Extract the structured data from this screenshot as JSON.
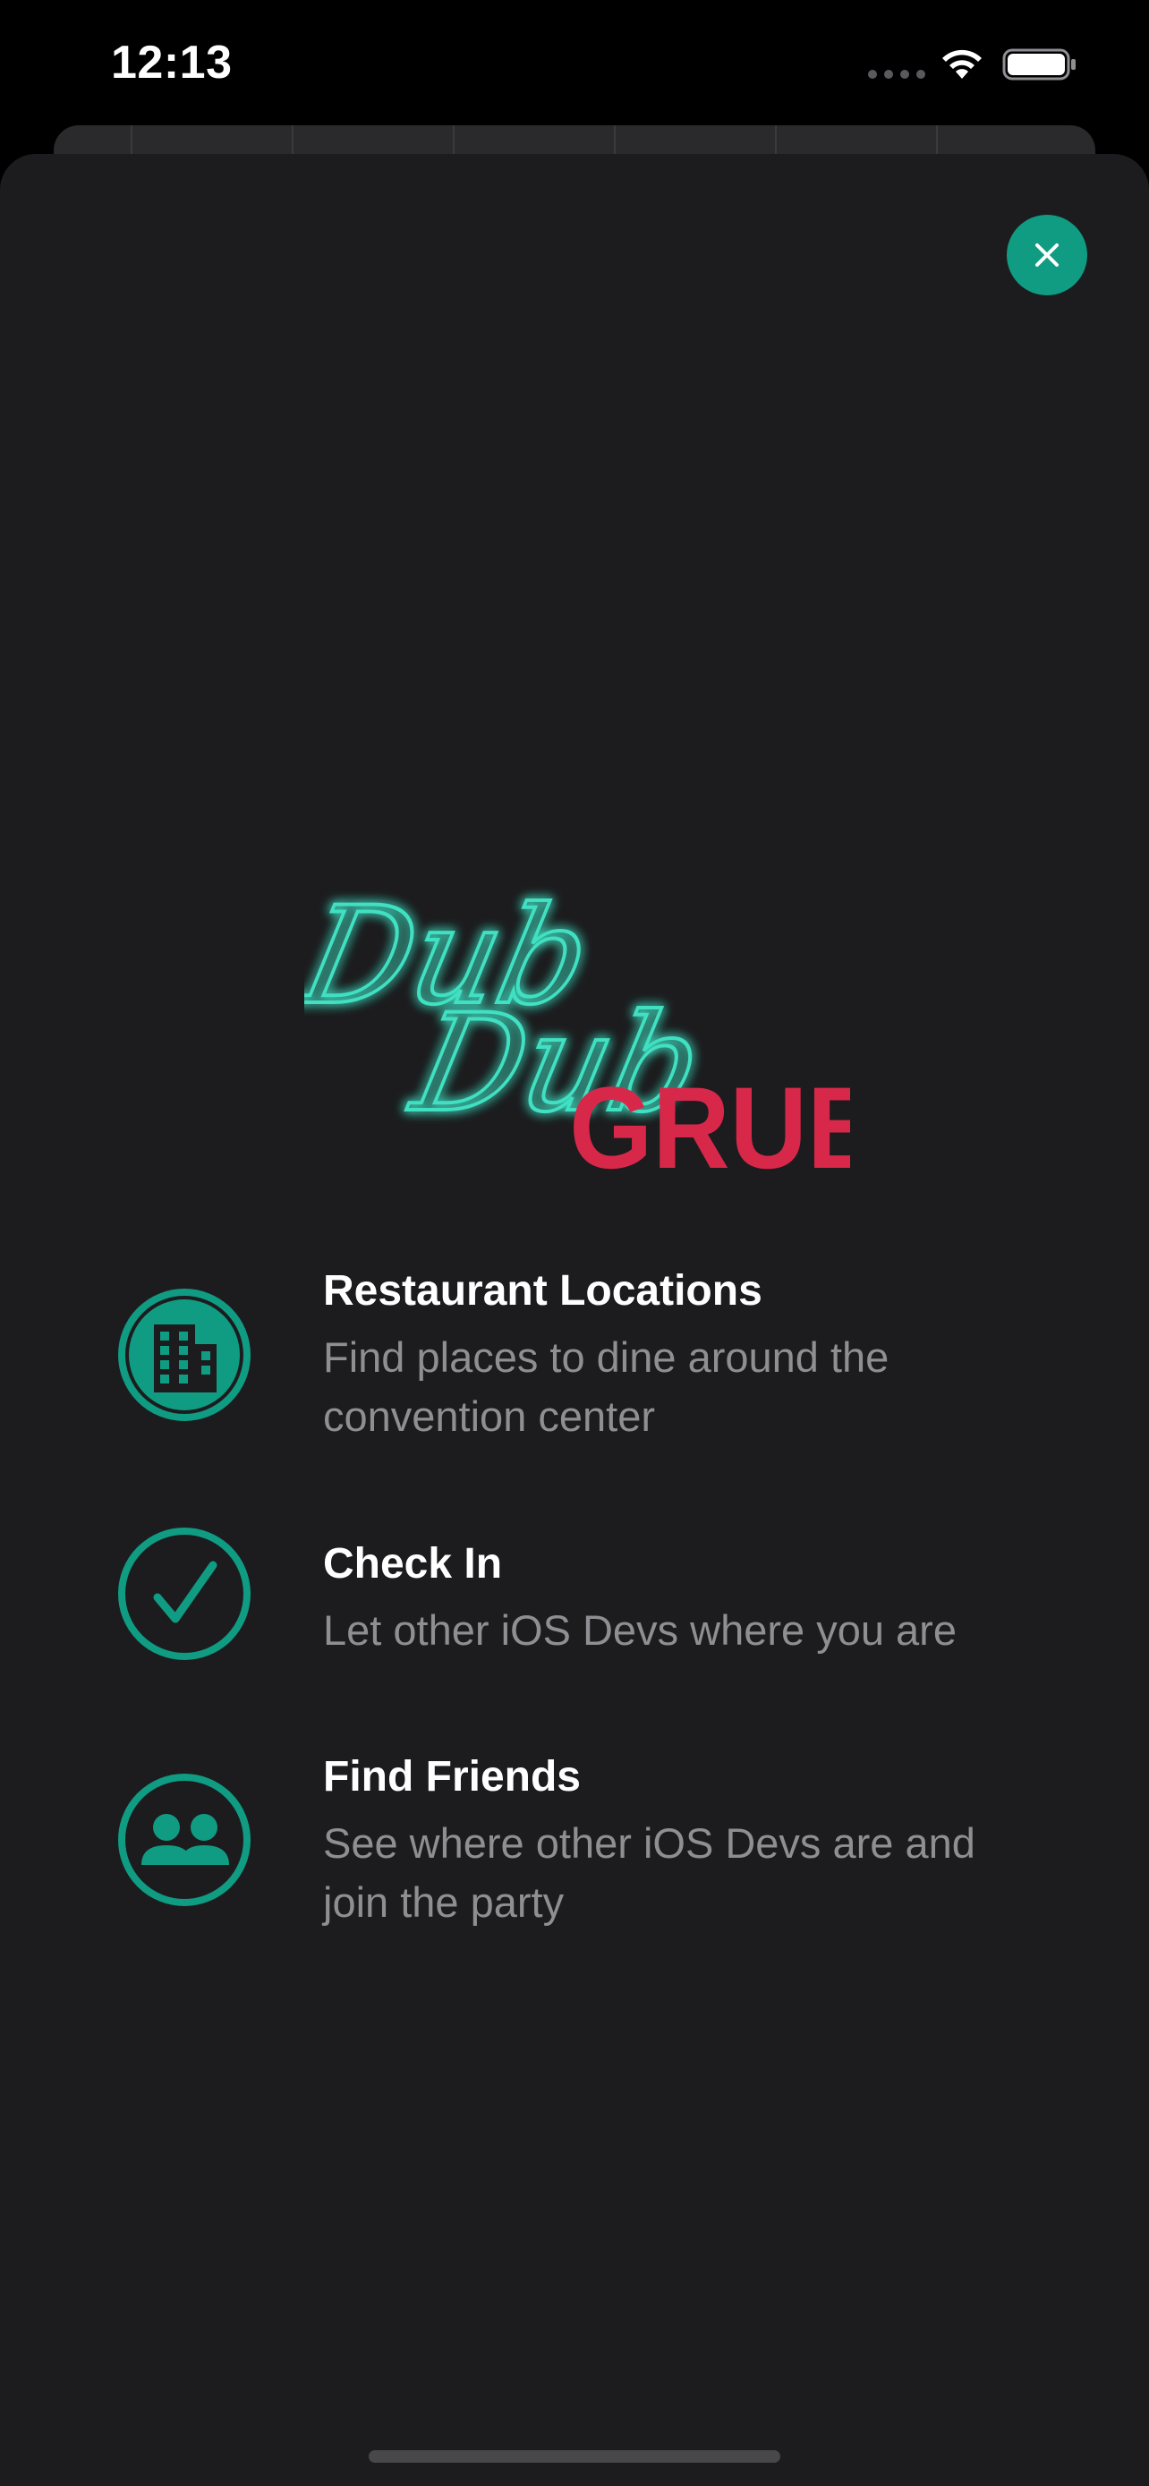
{
  "status_bar": {
    "time": "12:13"
  },
  "logo": {
    "line1": "Dub",
    "line2": "Dub",
    "word": "GRUB",
    "neon_color": "#3fe0c2",
    "word_color": "#d8284a"
  },
  "close_button": {
    "icon": "close-icon",
    "color": "#0f9c82"
  },
  "features": [
    {
      "icon": "building-icon",
      "title": "Restaurant Locations",
      "description": "Find places to dine around the convention center"
    },
    {
      "icon": "checkmark-icon",
      "title": "Check In",
      "description": "Let other iOS Devs where you are"
    },
    {
      "icon": "people-icon",
      "title": "Find Friends",
      "description": "See where other iOS Devs are and join the party"
    }
  ],
  "colors": {
    "accent": "#0f9c82",
    "sheet_background": "#1c1c1e",
    "secondary_text": "#8e8e93"
  }
}
